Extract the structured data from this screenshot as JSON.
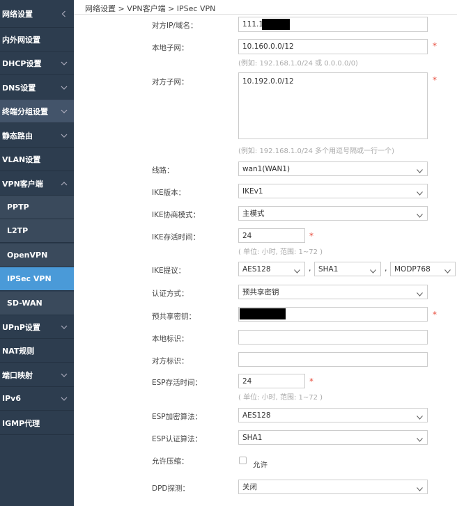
{
  "sidebar": {
    "items": [
      {
        "label": "网络设置",
        "chev": "left"
      },
      {
        "label": "内外网设置",
        "chev": ""
      },
      {
        "label": "DHCP设置",
        "chev": "down"
      },
      {
        "label": "DNS设置",
        "chev": "down"
      },
      {
        "label": "终端分组设置",
        "chev": "down"
      },
      {
        "label": "静态路由",
        "chev": "down"
      },
      {
        "label": "VLAN设置",
        "chev": ""
      },
      {
        "label": "VPN客户端",
        "chev": "up"
      },
      {
        "label": "PPTP",
        "chev": ""
      },
      {
        "label": "L2TP",
        "chev": ""
      },
      {
        "label": "OpenVPN",
        "chev": ""
      },
      {
        "label": "IPSec VPN",
        "chev": ""
      },
      {
        "label": "SD-WAN",
        "chev": ""
      },
      {
        "label": "UPnP设置",
        "chev": "down"
      },
      {
        "label": "NAT规则",
        "chev": ""
      },
      {
        "label": "端口映射",
        "chev": "down"
      },
      {
        "label": "IPv6",
        "chev": "down"
      },
      {
        "label": "IGMP代理",
        "chev": ""
      }
    ]
  },
  "breadcrumb": "网络设置 > VPN客户端 > IPSec VPN",
  "form": {
    "peer_ip": {
      "label": "对方IP/域名：",
      "value": "111.12"
    },
    "local_subnet": {
      "label": "本地子网：",
      "value": "10.160.0.0/12",
      "hint": "(例如: 192.168.1.0/24 或 0.0.0.0/0)"
    },
    "peer_subnet": {
      "label": "对方子网：",
      "value": "10.192.0.0/12",
      "hint": "(例如: 192.168.1.0/24 多个用逗号隔或一行一个)"
    },
    "line": {
      "label": "线路：",
      "value": "wan1(WAN1)"
    },
    "ike_version": {
      "label": "IKE版本：",
      "value": "IKEv1"
    },
    "ike_mode": {
      "label": "IKE协商模式：",
      "value": "主模式"
    },
    "ike_lifetime": {
      "label": "IKE存活时间：",
      "value": "24",
      "hint": "( 单位: 小时, 范围: 1~72 )"
    },
    "ike_proposal": {
      "label": "IKE提议：",
      "enc": "AES128",
      "hash": "SHA1",
      "dh": "MODP768",
      "sep": ","
    },
    "auth_method": {
      "label": "认证方式：",
      "value": "预共享密钥"
    },
    "psk": {
      "label": "预共享密钥："
    },
    "local_id": {
      "label": "本地标识："
    },
    "peer_id": {
      "label": "对方标识："
    },
    "esp_lifetime": {
      "label": "ESP存活时间：",
      "value": "24",
      "hint": "( 单位: 小时, 范围: 1~72 )"
    },
    "esp_enc": {
      "label": "ESP加密算法：",
      "value": "AES128"
    },
    "esp_auth": {
      "label": "ESP认证算法：",
      "value": "SHA1"
    },
    "compress": {
      "label": "允许压缩：",
      "option": "允许"
    },
    "dpd": {
      "label": "DPD探测：",
      "value": "关闭"
    },
    "required": "*"
  }
}
